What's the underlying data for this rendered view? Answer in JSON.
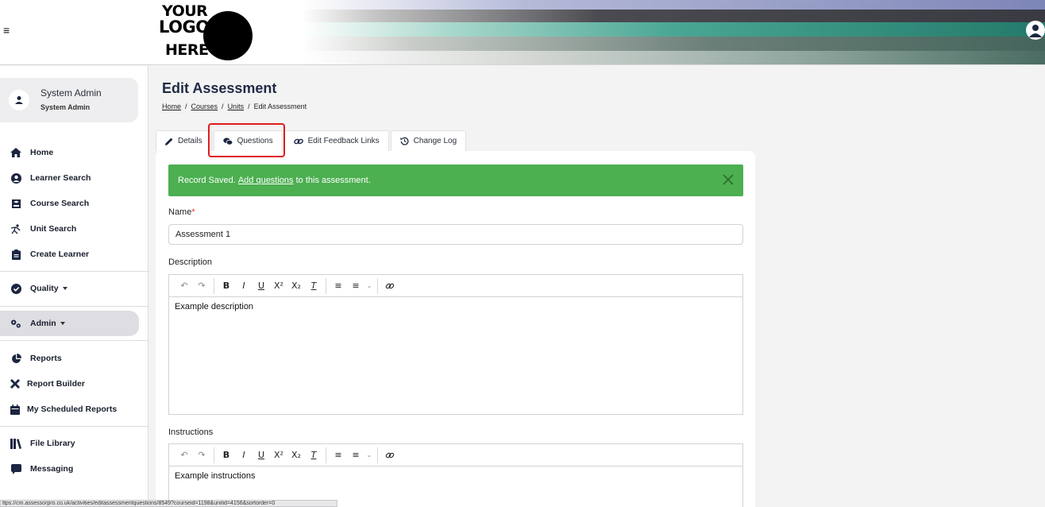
{
  "header": {
    "menu_icon": "hamburger-icon",
    "logo": {
      "line1": "YOUR",
      "line2": "LOGO",
      "line3": "HERE"
    },
    "user_icon": "user-circle-icon"
  },
  "sidebar": {
    "profile": {
      "name": "System Admin",
      "role": "System Admin"
    },
    "items": [
      {
        "label": "Home",
        "icon": "home-icon"
      },
      {
        "label": "Learner Search",
        "icon": "user-circle-icon"
      },
      {
        "label": "Course Search",
        "icon": "graduation-icon"
      },
      {
        "label": "Unit Search",
        "icon": "unit-icon"
      },
      {
        "label": "Create Learner",
        "icon": "clipboard-icon"
      },
      {
        "label": "Quality",
        "icon": "check-circle-icon"
      },
      {
        "label": "Admin",
        "icon": "cogs-icon"
      },
      {
        "label": "Reports",
        "icon": "pie-chart-icon"
      },
      {
        "label": "Report Builder",
        "icon": "tools-icon"
      },
      {
        "label": "My Scheduled Reports",
        "icon": "calendar-icon"
      },
      {
        "label": "File Library",
        "icon": "books-icon"
      },
      {
        "label": "Messaging",
        "icon": "message-icon"
      }
    ]
  },
  "page": {
    "title": "Edit Assessment",
    "breadcrumb": [
      "Home",
      "Courses",
      "Units",
      "Edit Assessment"
    ]
  },
  "tabs": [
    {
      "label": "Details",
      "icon": "pencil-icon"
    },
    {
      "label": "Questions",
      "icon": "comments-icon"
    },
    {
      "label": "Edit Feedback Links",
      "icon": "link-icon"
    },
    {
      "label": "Change Log",
      "icon": "history-icon"
    }
  ],
  "alert": {
    "prefix": "Record Saved. ",
    "link": "Add questions",
    "suffix": " to this assessment.",
    "color": "#4caf50"
  },
  "form": {
    "name_label": "Name",
    "name_required": "*",
    "name_value": "Assessment 1",
    "description_label": "Description",
    "description_value": "Example description",
    "instructions_label": "Instructions",
    "instructions_value": "Example instructions"
  },
  "status_url": "ttps://cm.assessorpro.co.uk/activities/editassessmentquestions/8549?courseid=1198&unitid=4156&sortorder=0"
}
